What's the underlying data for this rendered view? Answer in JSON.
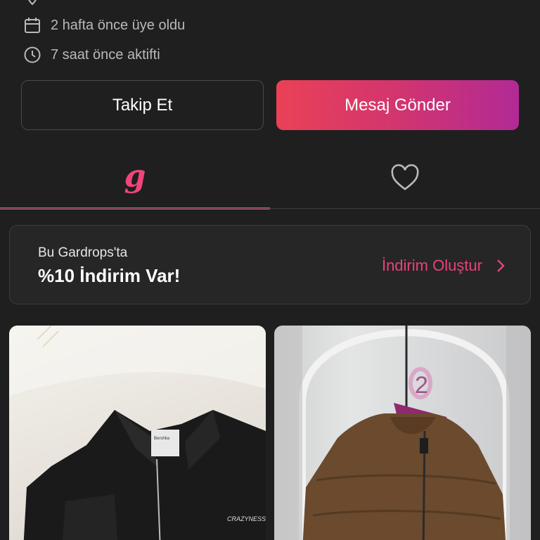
{
  "profile": {
    "member_since": "2 hafta önce üye oldu",
    "last_active": "7 saat önce aktifti"
  },
  "actions": {
    "follow_label": "Takip Et",
    "message_label": "Mesaj Gönder"
  },
  "tabs": [
    {
      "name": "wardrobe",
      "icon": "g-logo-icon",
      "glyph": "g",
      "selected": true
    },
    {
      "name": "likes",
      "icon": "heart-icon",
      "selected": false
    }
  ],
  "promo": {
    "subtitle": "Bu Gardrops'ta",
    "title": "%10 İndirim Var!",
    "link_label": "İndirim Oluştur"
  },
  "products": [
    {
      "description_icon": "black-jacket-photo",
      "brand_tag": "CRAZYNESS"
    },
    {
      "description_icon": "brown-puffer-jacket-photo",
      "hanger_number": "2"
    }
  ],
  "colors": {
    "background": "#1f1f1f",
    "accent": "#f0457a",
    "gradient_start": "#ea4156",
    "gradient_end": "#b12a95"
  }
}
